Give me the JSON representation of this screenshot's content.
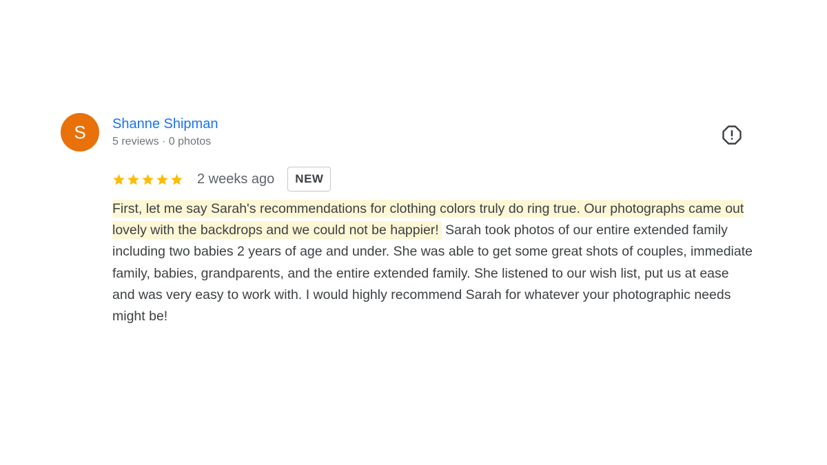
{
  "review": {
    "avatar_letter": "S",
    "author_name": "Shanne Shipman",
    "author_meta": "5 reviews · 0 photos",
    "rating": 5,
    "rating_max": 5,
    "time_ago": "2 weeks ago",
    "badge": "NEW",
    "text_highlighted": "First, let me say Sarah's recommendations for clothing colors truly do ring true. Our photographs came out lovely with the backdrops and we could not be happier!",
    "text_rest": " Sarah took photos of our entire extended family including two babies 2 years of age and under. She was able to get some great shots of couples, immediate family, babies, grandparents, and the entire extended family. She listened to our wish list, put us at ease and was very easy to work with. I would highly recommend Sarah for whatever your photographic needs might be!",
    "report_icon": "report-flag-icon"
  },
  "colors": {
    "avatar_bg": "#e8710a",
    "author_link": "#1a73e8",
    "star": "#fbbc04",
    "highlight_bg": "#fef7d6",
    "text": "#3c4043"
  }
}
